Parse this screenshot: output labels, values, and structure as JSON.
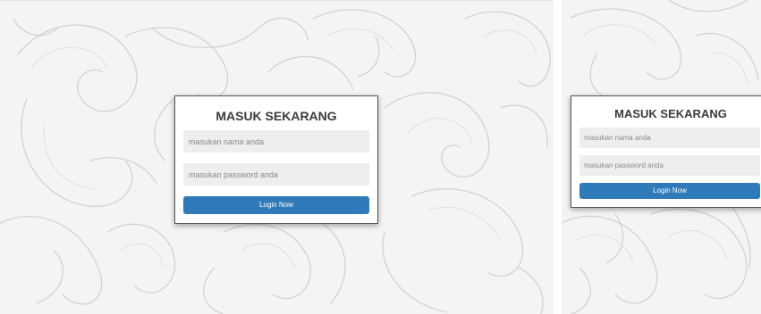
{
  "colors": {
    "background": "#f4f4f4",
    "pattern_stroke": "#cfcfcf",
    "button": "#2f7ab8",
    "field": "#eeeeee",
    "title": "#3b3b3b"
  },
  "views": [
    {
      "login": {
        "title": "MASUK SEKARANG",
        "username_placeholder": "masukan nama anda",
        "password_placeholder": "masukan password anda",
        "button_label": "Login Now"
      }
    },
    {
      "login": {
        "title": "MASUK SEKARANG",
        "username_placeholder": "masukan nama anda",
        "password_placeholder": "masukan password anda",
        "button_label": "Login Now"
      }
    }
  ]
}
